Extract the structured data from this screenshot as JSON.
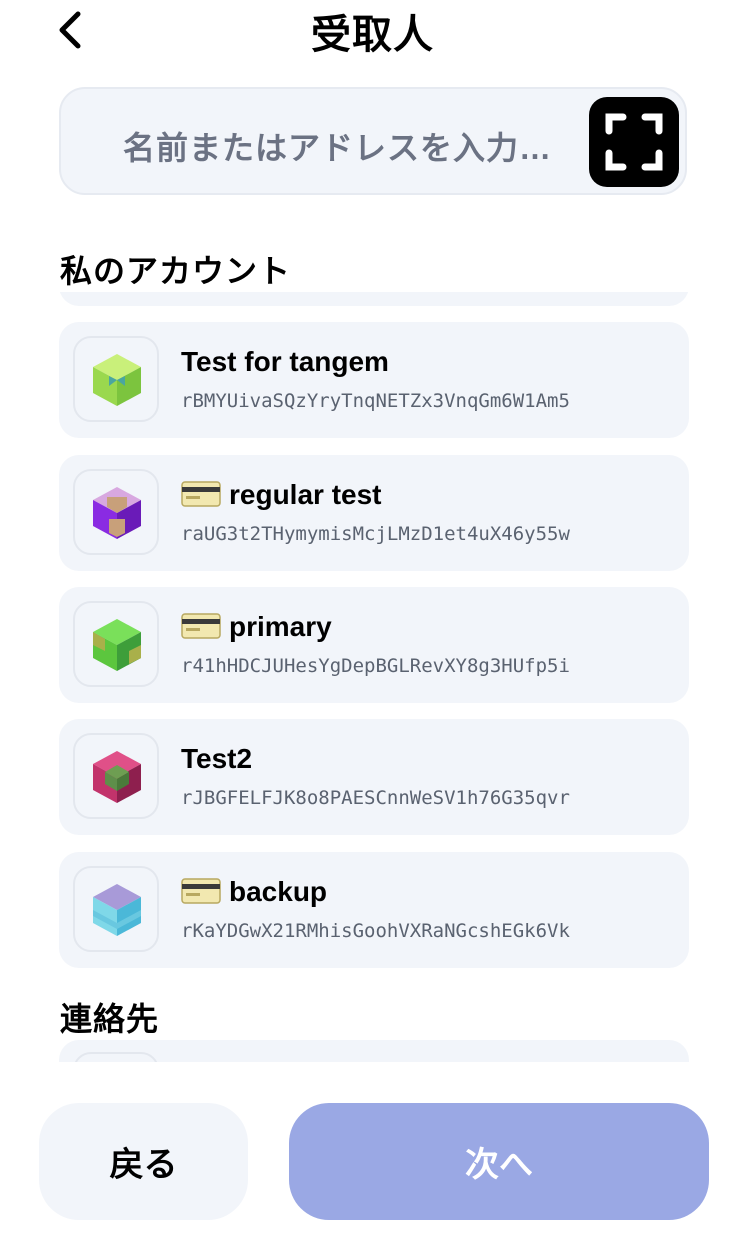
{
  "header": {
    "title": "受取人"
  },
  "search": {
    "placeholder": "名前またはアドレスを入力…"
  },
  "sections": {
    "my_accounts": "私のアカウント",
    "contacts": "連絡先"
  },
  "accounts": [
    {
      "name": "Test for tangem",
      "address": "rBMYUivaSQzYryTnqNETZx3VnqGm6W1Am5",
      "has_card_icon": false
    },
    {
      "name": "regular test",
      "address": "raUG3t2THymymisMcjLMzD1et4uX46y55w",
      "has_card_icon": true
    },
    {
      "name": "primary",
      "address": "r41hHDCJUHesYgDepBGLRevXY8g3HUfp5i",
      "has_card_icon": true
    },
    {
      "name": "Test2",
      "address": "rJBGFELFJK8o8PAESCnnWeSV1h76G35qvr",
      "has_card_icon": false
    },
    {
      "name": "backup",
      "address": "rKaYDGwX21RMhisGoohVXRaNGcshEGk6Vk",
      "has_card_icon": true
    }
  ],
  "footer": {
    "back_label": "戻る",
    "next_label": "次へ"
  },
  "icons": {
    "back": "chevron-left-icon",
    "scan": "qr-scan-icon",
    "card": "credit-card-icon",
    "avatar": "cube-avatar-icon"
  },
  "colors": {
    "accent_disabled": "#9aa8e4",
    "surface": "#f2f5fa",
    "avatar_1": [
      "#b6e85a",
      "#8fd14a",
      "#3fa0a0"
    ],
    "avatar_2": [
      "#8a2be2",
      "#6a1bb8",
      "#c8a07a"
    ],
    "avatar_3": [
      "#6ad64a",
      "#3e9e3a",
      "#a9b04a"
    ],
    "avatar_4": [
      "#c2336b",
      "#8e1f4e",
      "#5e8f4a"
    ],
    "avatar_5": [
      "#7fd8e8",
      "#4bb8d8",
      "#a89ad8"
    ]
  }
}
